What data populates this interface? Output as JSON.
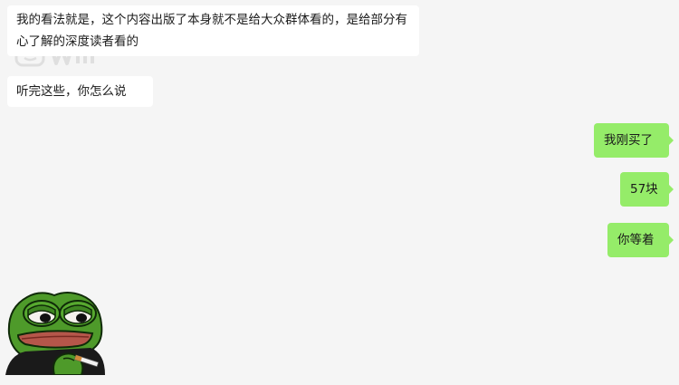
{
  "messages": [
    {
      "side": "left",
      "text": "我的看法就是，这个内容出版了本身就不是给大众群体看的，是给部分有心了解的深度读者看的"
    },
    {
      "side": "left",
      "text": "听完这些，你怎么说"
    },
    {
      "side": "right",
      "text": "我刚买了"
    },
    {
      "side": "right",
      "text": "57块"
    },
    {
      "side": "right",
      "text": "你等着"
    }
  ],
  "sticker": {
    "icon": "pepe-frog-smoking-sticker"
  },
  "watermark": {
    "icon": "app-logo-watermark"
  },
  "colors": {
    "background": "#f5f5f5",
    "incoming_bubble": "#ffffff",
    "outgoing_bubble": "#95ec69",
    "text": "#1a1a1a"
  }
}
